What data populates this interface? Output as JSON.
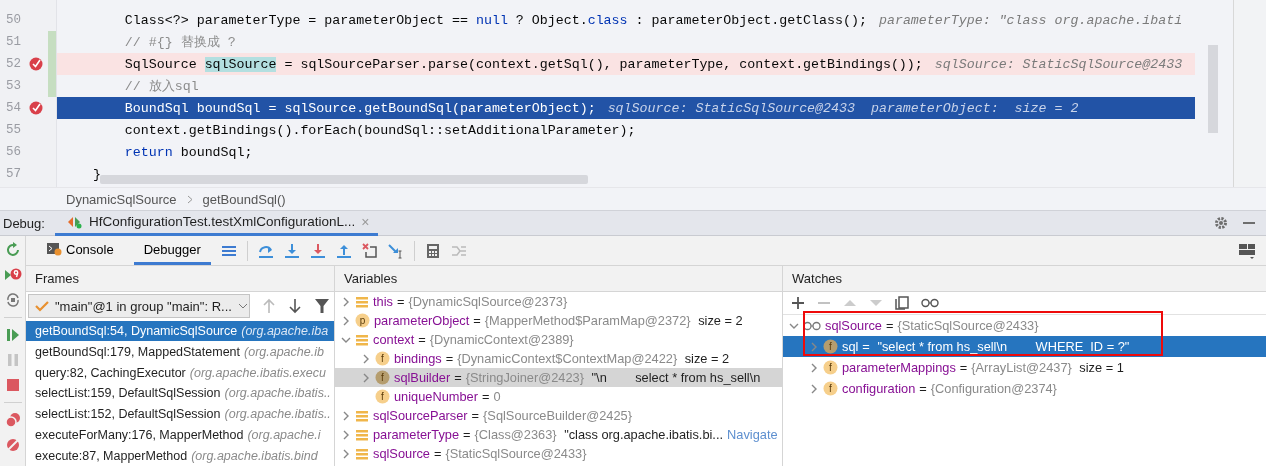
{
  "editor": {
    "lines": [
      {
        "number": "50",
        "current": false,
        "breakpoint": false,
        "changed": false,
        "segments": [
          {
            "kind": "code",
            "text": "        Class<?> parameterType = parameterObject == "
          },
          {
            "kind": "keyword",
            "text": "null"
          },
          {
            "kind": "code",
            "text": " ? Object."
          },
          {
            "kind": "keyword",
            "text": "class"
          },
          {
            "kind": "code",
            "text": " : parameterObject.getClass();"
          }
        ],
        "hint": "parameterType: \"class org.apache.ibati"
      },
      {
        "number": "51",
        "current": false,
        "breakpoint": false,
        "changed": true,
        "segments": [
          {
            "kind": "comment",
            "text": "        // #{} 替换成 ?"
          }
        ]
      },
      {
        "number": "52",
        "current": false,
        "breakpoint": true,
        "changed": true,
        "segments": [
          {
            "kind": "code",
            "text": "        SqlSource "
          },
          {
            "kind": "match",
            "text": "sqlSource"
          },
          {
            "kind": "code",
            "text": " = sqlSourceParser.parse(context.getSql(), parameterType, context.getBindings());"
          }
        ],
        "hint": "sqlSource: StaticSqlSource@2433"
      },
      {
        "number": "53",
        "current": false,
        "breakpoint": false,
        "changed": true,
        "segments": [
          {
            "kind": "comment",
            "text": "        // 放入sql"
          }
        ]
      },
      {
        "number": "54",
        "current": true,
        "breakpoint": true,
        "changed": false,
        "segments": [
          {
            "kind": "code",
            "text": "        BoundSql boundSql = sqlSource.getBoundSql(parameterObject);"
          }
        ],
        "hint": "sqlSource: StaticSqlSource@2433  parameterObject:  size = 2"
      },
      {
        "number": "55",
        "current": false,
        "breakpoint": false,
        "changed": false,
        "segments": [
          {
            "kind": "code",
            "text": "        context.getBindings().forEach(boundSql::setAdditionalParameter);"
          }
        ]
      },
      {
        "number": "56",
        "current": false,
        "breakpoint": false,
        "changed": false,
        "segments": [
          {
            "kind": "keyword",
            "text": "        return"
          },
          {
            "kind": "code",
            "text": " boundSql;"
          }
        ]
      },
      {
        "number": "57",
        "current": false,
        "breakpoint": false,
        "changed": false,
        "segments": [
          {
            "kind": "code",
            "text": "    }"
          }
        ]
      }
    ]
  },
  "breadcrumb": [
    "DynamicSqlSource",
    "getBoundSql()"
  ],
  "debug": {
    "label": "Debug:",
    "session_tab": "HfConfigurationTest.testXmlConfigurationL...",
    "close_glyph": "×"
  },
  "tabs": [
    {
      "label": "Console",
      "selected": false
    },
    {
      "label": "Debugger",
      "selected": true
    }
  ],
  "frames": {
    "header": "Frames",
    "thread": "\"main\"@1 in group \"main\": R...",
    "items": [
      {
        "method": "getBoundSql:54, DynamicSqlSource",
        "package": "(org.apache.iba",
        "selected": true
      },
      {
        "method": "getBoundSql:179, MappedStatement",
        "package": "(org.apache.ib",
        "selected": false
      },
      {
        "method": "query:82, CachingExecutor",
        "package": "(org.apache.ibatis.execu",
        "selected": false
      },
      {
        "method": "selectList:159, DefaultSqlSession",
        "package": "(org.apache.ibatis..",
        "selected": false
      },
      {
        "method": "selectList:152, DefaultSqlSession",
        "package": "(org.apache.ibatis..",
        "selected": false
      },
      {
        "method": "executeForMany:176, MapperMethod",
        "package": "(org.apache.i",
        "selected": false
      },
      {
        "method": "execute:87, MapperMethod",
        "package": "(org.apache.ibatis.bind",
        "selected": false
      }
    ]
  },
  "variables": {
    "header": "Variables",
    "items": [
      {
        "kind": "local",
        "name": "this",
        "op": "=",
        "value": "{DynamicSqlSource@2373}",
        "expanded": false,
        "selected": false
      },
      {
        "kind": "parameter",
        "icon_letter": "p",
        "name": "parameterObject",
        "op": "=",
        "value": "{MapperMethod$ParamMap@2372}",
        "extra": "size = 2",
        "expanded": false,
        "selected": false
      },
      {
        "kind": "local",
        "name": "context",
        "op": "=",
        "value": "{DynamicContext@2389}",
        "expanded": true,
        "selected": false,
        "children": [
          {
            "kind": "field",
            "icon_letter": "f",
            "name": "bindings",
            "op": "=",
            "value": "{DynamicContext$ContextMap@2422}",
            "extra": "size = 2",
            "expanded": false,
            "selected": false
          },
          {
            "kind": "field",
            "icon_letter": "f",
            "name": "sqlBuilder",
            "op": "=",
            "value": "{StringJoiner@2423}",
            "extra": "\"\\n        select * from hs_sell\\n",
            "expanded": false,
            "selected": true
          },
          {
            "kind": "field",
            "icon_letter": "f",
            "name": "uniqueNumber",
            "op": "=",
            "value": "0",
            "selected": false
          }
        ]
      },
      {
        "kind": "local",
        "name": "sqlSourceParser",
        "op": "=",
        "value": "{SqlSourceBuilder@2425}",
        "expanded": false,
        "selected": false
      },
      {
        "kind": "local",
        "name": "parameterType",
        "op": "=",
        "value": "{Class@2363}",
        "extra": "\"class org.apache.ibatis.bi...",
        "link": "Navigate",
        "expanded": false,
        "selected": false
      },
      {
        "kind": "local",
        "name": "sqlSource",
        "op": "=",
        "value": "{StaticSqlSource@2433}",
        "expanded": false,
        "selected": false
      }
    ]
  },
  "watches": {
    "header": "Watches",
    "annotation_box": true,
    "items": [
      {
        "kind": "watch",
        "name": "sqlSource",
        "op": "=",
        "value": "{StaticSqlSource@2433}",
        "expanded": true,
        "selected": false,
        "children": [
          {
            "kind": "field",
            "icon_letter": "f",
            "name": "sql",
            "op": "=",
            "extra": "\"select * from hs_sell\\n        WHERE  ID = ?\"",
            "expanded": false,
            "selected": true
          },
          {
            "kind": "field",
            "icon_letter": "f",
            "name": "parameterMappings",
            "op": "=",
            "value": "{ArrayList@2437}",
            "extra": "size = 1",
            "expanded": false,
            "selected": false
          },
          {
            "kind": "field",
            "icon_letter": "f",
            "name": "configuration",
            "op": "=",
            "value": "{Configuration@2374}",
            "expanded": false,
            "selected": false
          }
        ]
      }
    ]
  }
}
